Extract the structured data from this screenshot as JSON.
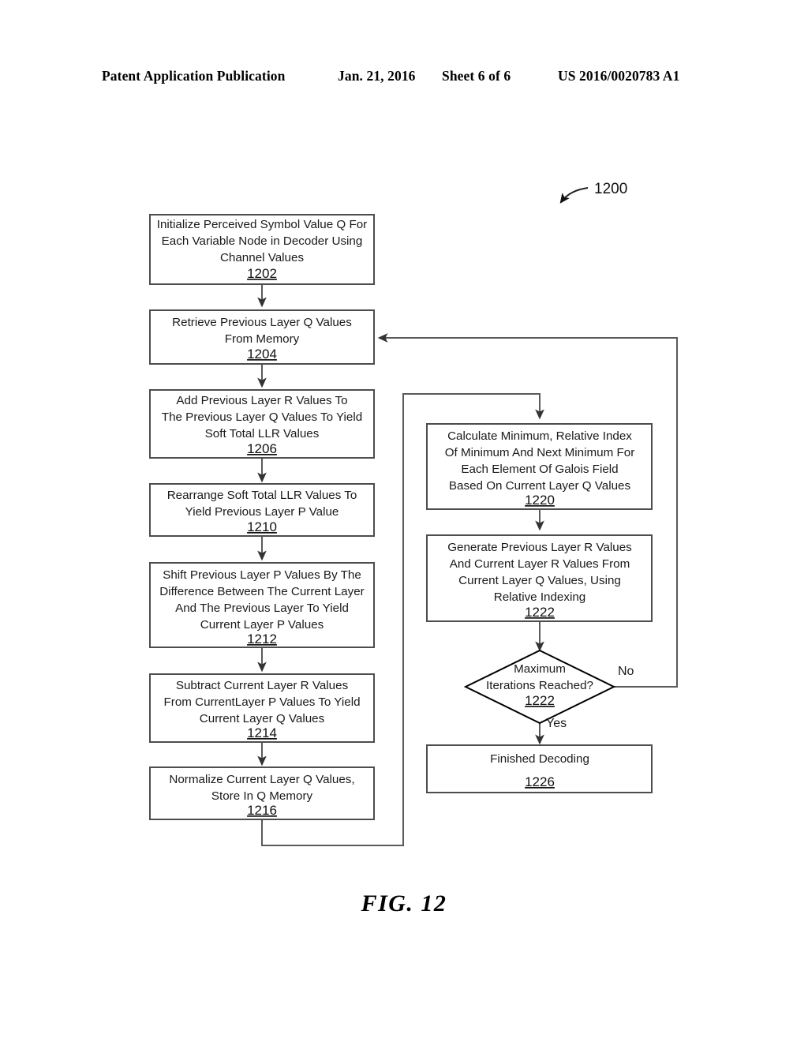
{
  "header": {
    "publication": "Patent Application Publication",
    "date": "Jan. 21, 2016",
    "sheet": "Sheet 6 of 6",
    "patent_number": "US 2016/0020783 A1"
  },
  "figure": {
    "caption": "FIG. 12",
    "diagram_ref": "1200"
  },
  "flowchart": {
    "nodes": [
      {
        "id": "n1202",
        "shape": "process",
        "ref": "1202",
        "lines": [
          "Initialize Perceived Symbol Value Q For",
          "Each Variable Node in Decoder Using",
          "Channel Values"
        ]
      },
      {
        "id": "n1204",
        "shape": "process",
        "ref": "1204",
        "lines": [
          "Retrieve Previous Layer Q Values",
          "From Memory"
        ]
      },
      {
        "id": "n1206",
        "shape": "process",
        "ref": "1206",
        "lines": [
          "Add Previous Layer R Values To",
          "The Previous Layer Q Values To Yield",
          "Soft Total LLR Values"
        ]
      },
      {
        "id": "n1210",
        "shape": "process",
        "ref": "1210",
        "lines": [
          "Rearrange Soft Total LLR Values To",
          "Yield Previous Layer P Value"
        ]
      },
      {
        "id": "n1212",
        "shape": "process",
        "ref": "1212",
        "lines": [
          "Shift Previous Layer P Values By The",
          "Difference Between The Current Layer",
          "And The Previous Layer To Yield",
          "Current Layer P Values"
        ]
      },
      {
        "id": "n1214",
        "shape": "process",
        "ref": "1214",
        "lines": [
          "Subtract Current Layer R Values",
          "From CurrentLayer P Values To Yield",
          "Current Layer Q Values"
        ]
      },
      {
        "id": "n1216",
        "shape": "process",
        "ref": "1216",
        "lines": [
          "Normalize Current Layer Q Values,",
          "Store In Q Memory"
        ]
      },
      {
        "id": "n1220",
        "shape": "process",
        "ref": "1220",
        "lines": [
          "Calculate Minimum, Relative Index",
          "Of Minimum And Next Minimum For",
          "Each Element Of Galois Field",
          "Based On Current Layer Q Values"
        ]
      },
      {
        "id": "n1222a",
        "shape": "process",
        "ref": "1222",
        "lines": [
          "Generate Previous Layer R Values",
          "And Current Layer R Values From",
          "Current Layer Q Values, Using",
          "Relative Indexing"
        ]
      },
      {
        "id": "n1222b",
        "shape": "decision",
        "ref": "1222",
        "lines": [
          "Maximum",
          "Iterations Reached?"
        ]
      },
      {
        "id": "n1226",
        "shape": "terminal",
        "ref": "1226",
        "lines": [
          "Finished Decoding"
        ]
      }
    ],
    "edge_labels": {
      "decision_no": "No",
      "decision_yes": "Yes"
    }
  }
}
